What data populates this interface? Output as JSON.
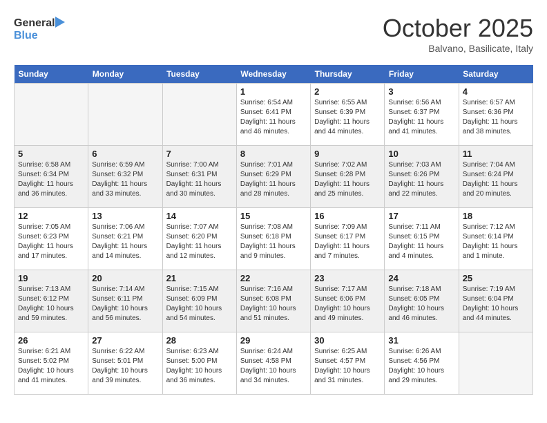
{
  "header": {
    "logo_line1": "General",
    "logo_line2": "Blue",
    "month": "October 2025",
    "location": "Balvano, Basilicate, Italy"
  },
  "days_of_week": [
    "Sunday",
    "Monday",
    "Tuesday",
    "Wednesday",
    "Thursday",
    "Friday",
    "Saturday"
  ],
  "weeks": [
    [
      {
        "day": "",
        "info": ""
      },
      {
        "day": "",
        "info": ""
      },
      {
        "day": "",
        "info": ""
      },
      {
        "day": "1",
        "info": "Sunrise: 6:54 AM\nSunset: 6:41 PM\nDaylight: 11 hours and 46 minutes."
      },
      {
        "day": "2",
        "info": "Sunrise: 6:55 AM\nSunset: 6:39 PM\nDaylight: 11 hours and 44 minutes."
      },
      {
        "day": "3",
        "info": "Sunrise: 6:56 AM\nSunset: 6:37 PM\nDaylight: 11 hours and 41 minutes."
      },
      {
        "day": "4",
        "info": "Sunrise: 6:57 AM\nSunset: 6:36 PM\nDaylight: 11 hours and 38 minutes."
      }
    ],
    [
      {
        "day": "5",
        "info": "Sunrise: 6:58 AM\nSunset: 6:34 PM\nDaylight: 11 hours and 36 minutes."
      },
      {
        "day": "6",
        "info": "Sunrise: 6:59 AM\nSunset: 6:32 PM\nDaylight: 11 hours and 33 minutes."
      },
      {
        "day": "7",
        "info": "Sunrise: 7:00 AM\nSunset: 6:31 PM\nDaylight: 11 hours and 30 minutes."
      },
      {
        "day": "8",
        "info": "Sunrise: 7:01 AM\nSunset: 6:29 PM\nDaylight: 11 hours and 28 minutes."
      },
      {
        "day": "9",
        "info": "Sunrise: 7:02 AM\nSunset: 6:28 PM\nDaylight: 11 hours and 25 minutes."
      },
      {
        "day": "10",
        "info": "Sunrise: 7:03 AM\nSunset: 6:26 PM\nDaylight: 11 hours and 22 minutes."
      },
      {
        "day": "11",
        "info": "Sunrise: 7:04 AM\nSunset: 6:24 PM\nDaylight: 11 hours and 20 minutes."
      }
    ],
    [
      {
        "day": "12",
        "info": "Sunrise: 7:05 AM\nSunset: 6:23 PM\nDaylight: 11 hours and 17 minutes."
      },
      {
        "day": "13",
        "info": "Sunrise: 7:06 AM\nSunset: 6:21 PM\nDaylight: 11 hours and 14 minutes."
      },
      {
        "day": "14",
        "info": "Sunrise: 7:07 AM\nSunset: 6:20 PM\nDaylight: 11 hours and 12 minutes."
      },
      {
        "day": "15",
        "info": "Sunrise: 7:08 AM\nSunset: 6:18 PM\nDaylight: 11 hours and 9 minutes."
      },
      {
        "day": "16",
        "info": "Sunrise: 7:09 AM\nSunset: 6:17 PM\nDaylight: 11 hours and 7 minutes."
      },
      {
        "day": "17",
        "info": "Sunrise: 7:11 AM\nSunset: 6:15 PM\nDaylight: 11 hours and 4 minutes."
      },
      {
        "day": "18",
        "info": "Sunrise: 7:12 AM\nSunset: 6:14 PM\nDaylight: 11 hours and 1 minute."
      }
    ],
    [
      {
        "day": "19",
        "info": "Sunrise: 7:13 AM\nSunset: 6:12 PM\nDaylight: 10 hours and 59 minutes."
      },
      {
        "day": "20",
        "info": "Sunrise: 7:14 AM\nSunset: 6:11 PM\nDaylight: 10 hours and 56 minutes."
      },
      {
        "day": "21",
        "info": "Sunrise: 7:15 AM\nSunset: 6:09 PM\nDaylight: 10 hours and 54 minutes."
      },
      {
        "day": "22",
        "info": "Sunrise: 7:16 AM\nSunset: 6:08 PM\nDaylight: 10 hours and 51 minutes."
      },
      {
        "day": "23",
        "info": "Sunrise: 7:17 AM\nSunset: 6:06 PM\nDaylight: 10 hours and 49 minutes."
      },
      {
        "day": "24",
        "info": "Sunrise: 7:18 AM\nSunset: 6:05 PM\nDaylight: 10 hours and 46 minutes."
      },
      {
        "day": "25",
        "info": "Sunrise: 7:19 AM\nSunset: 6:04 PM\nDaylight: 10 hours and 44 minutes."
      }
    ],
    [
      {
        "day": "26",
        "info": "Sunrise: 6:21 AM\nSunset: 5:02 PM\nDaylight: 10 hours and 41 minutes."
      },
      {
        "day": "27",
        "info": "Sunrise: 6:22 AM\nSunset: 5:01 PM\nDaylight: 10 hours and 39 minutes."
      },
      {
        "day": "28",
        "info": "Sunrise: 6:23 AM\nSunset: 5:00 PM\nDaylight: 10 hours and 36 minutes."
      },
      {
        "day": "29",
        "info": "Sunrise: 6:24 AM\nSunset: 4:58 PM\nDaylight: 10 hours and 34 minutes."
      },
      {
        "day": "30",
        "info": "Sunrise: 6:25 AM\nSunset: 4:57 PM\nDaylight: 10 hours and 31 minutes."
      },
      {
        "day": "31",
        "info": "Sunrise: 6:26 AM\nSunset: 4:56 PM\nDaylight: 10 hours and 29 minutes."
      },
      {
        "day": "",
        "info": ""
      }
    ]
  ]
}
